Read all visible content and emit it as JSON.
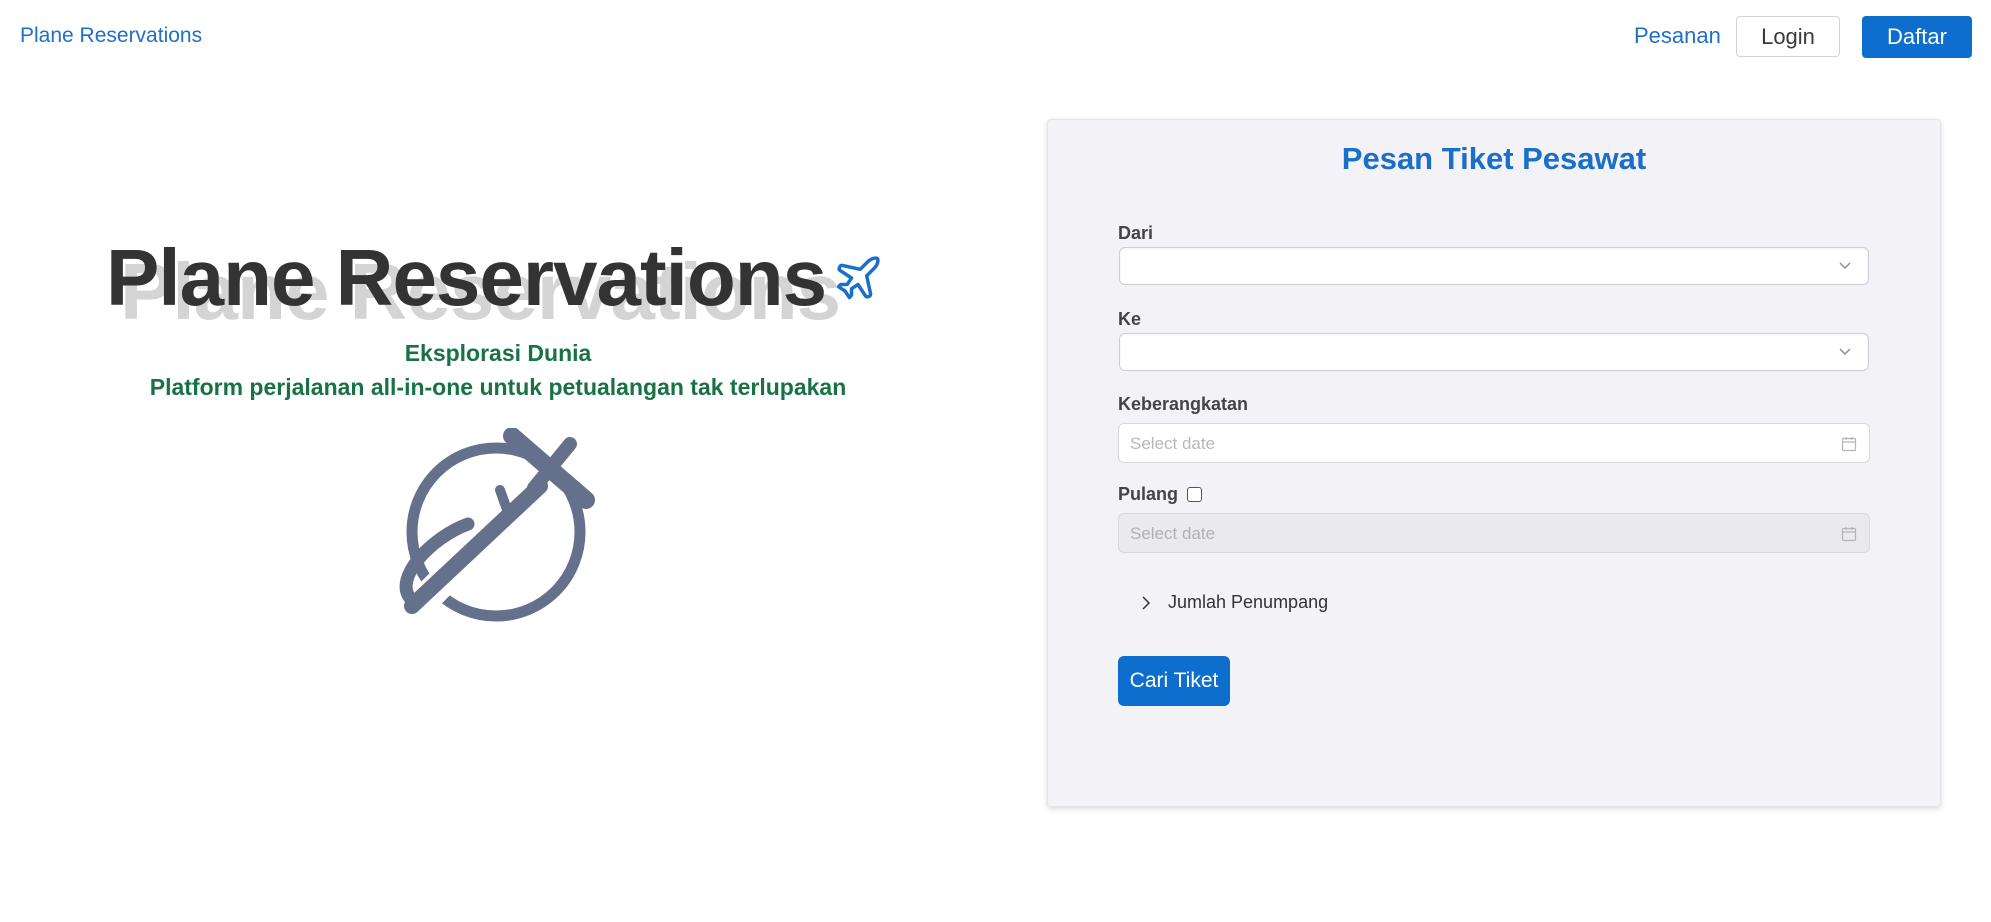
{
  "navbar": {
    "brand": "Plane Reservations",
    "orders_link": "Pesanan",
    "login_label": "Login",
    "register_label": "Daftar"
  },
  "hero": {
    "title": "Plane Reservations",
    "tagline_line1": "Eksplorasi Dunia",
    "tagline_line2": "Platform perjalanan all-in-one untuk petualangan tak terlupakan",
    "title_icon": "airplane-icon",
    "illustration_icon": "globe-airplane-icon"
  },
  "form": {
    "title": "Pesan Tiket Pesawat",
    "from_label": "Dari",
    "from_value": "",
    "to_label": "Ke",
    "to_value": "",
    "departure_label": "Keberangkatan",
    "departure_placeholder": "Select date",
    "return_label": "Pulang",
    "return_checked": false,
    "return_placeholder": "Select date",
    "return_disabled": true,
    "passengers_label": "Jumlah Penumpang",
    "submit_label": "Cari Tiket"
  },
  "colors": {
    "primary": "#0d6ecd",
    "link": "#1f6fc4",
    "tagline": "#187245",
    "title_dark": "#333333",
    "illustration": "#64708c",
    "card_bg": "#f3f3f7"
  }
}
